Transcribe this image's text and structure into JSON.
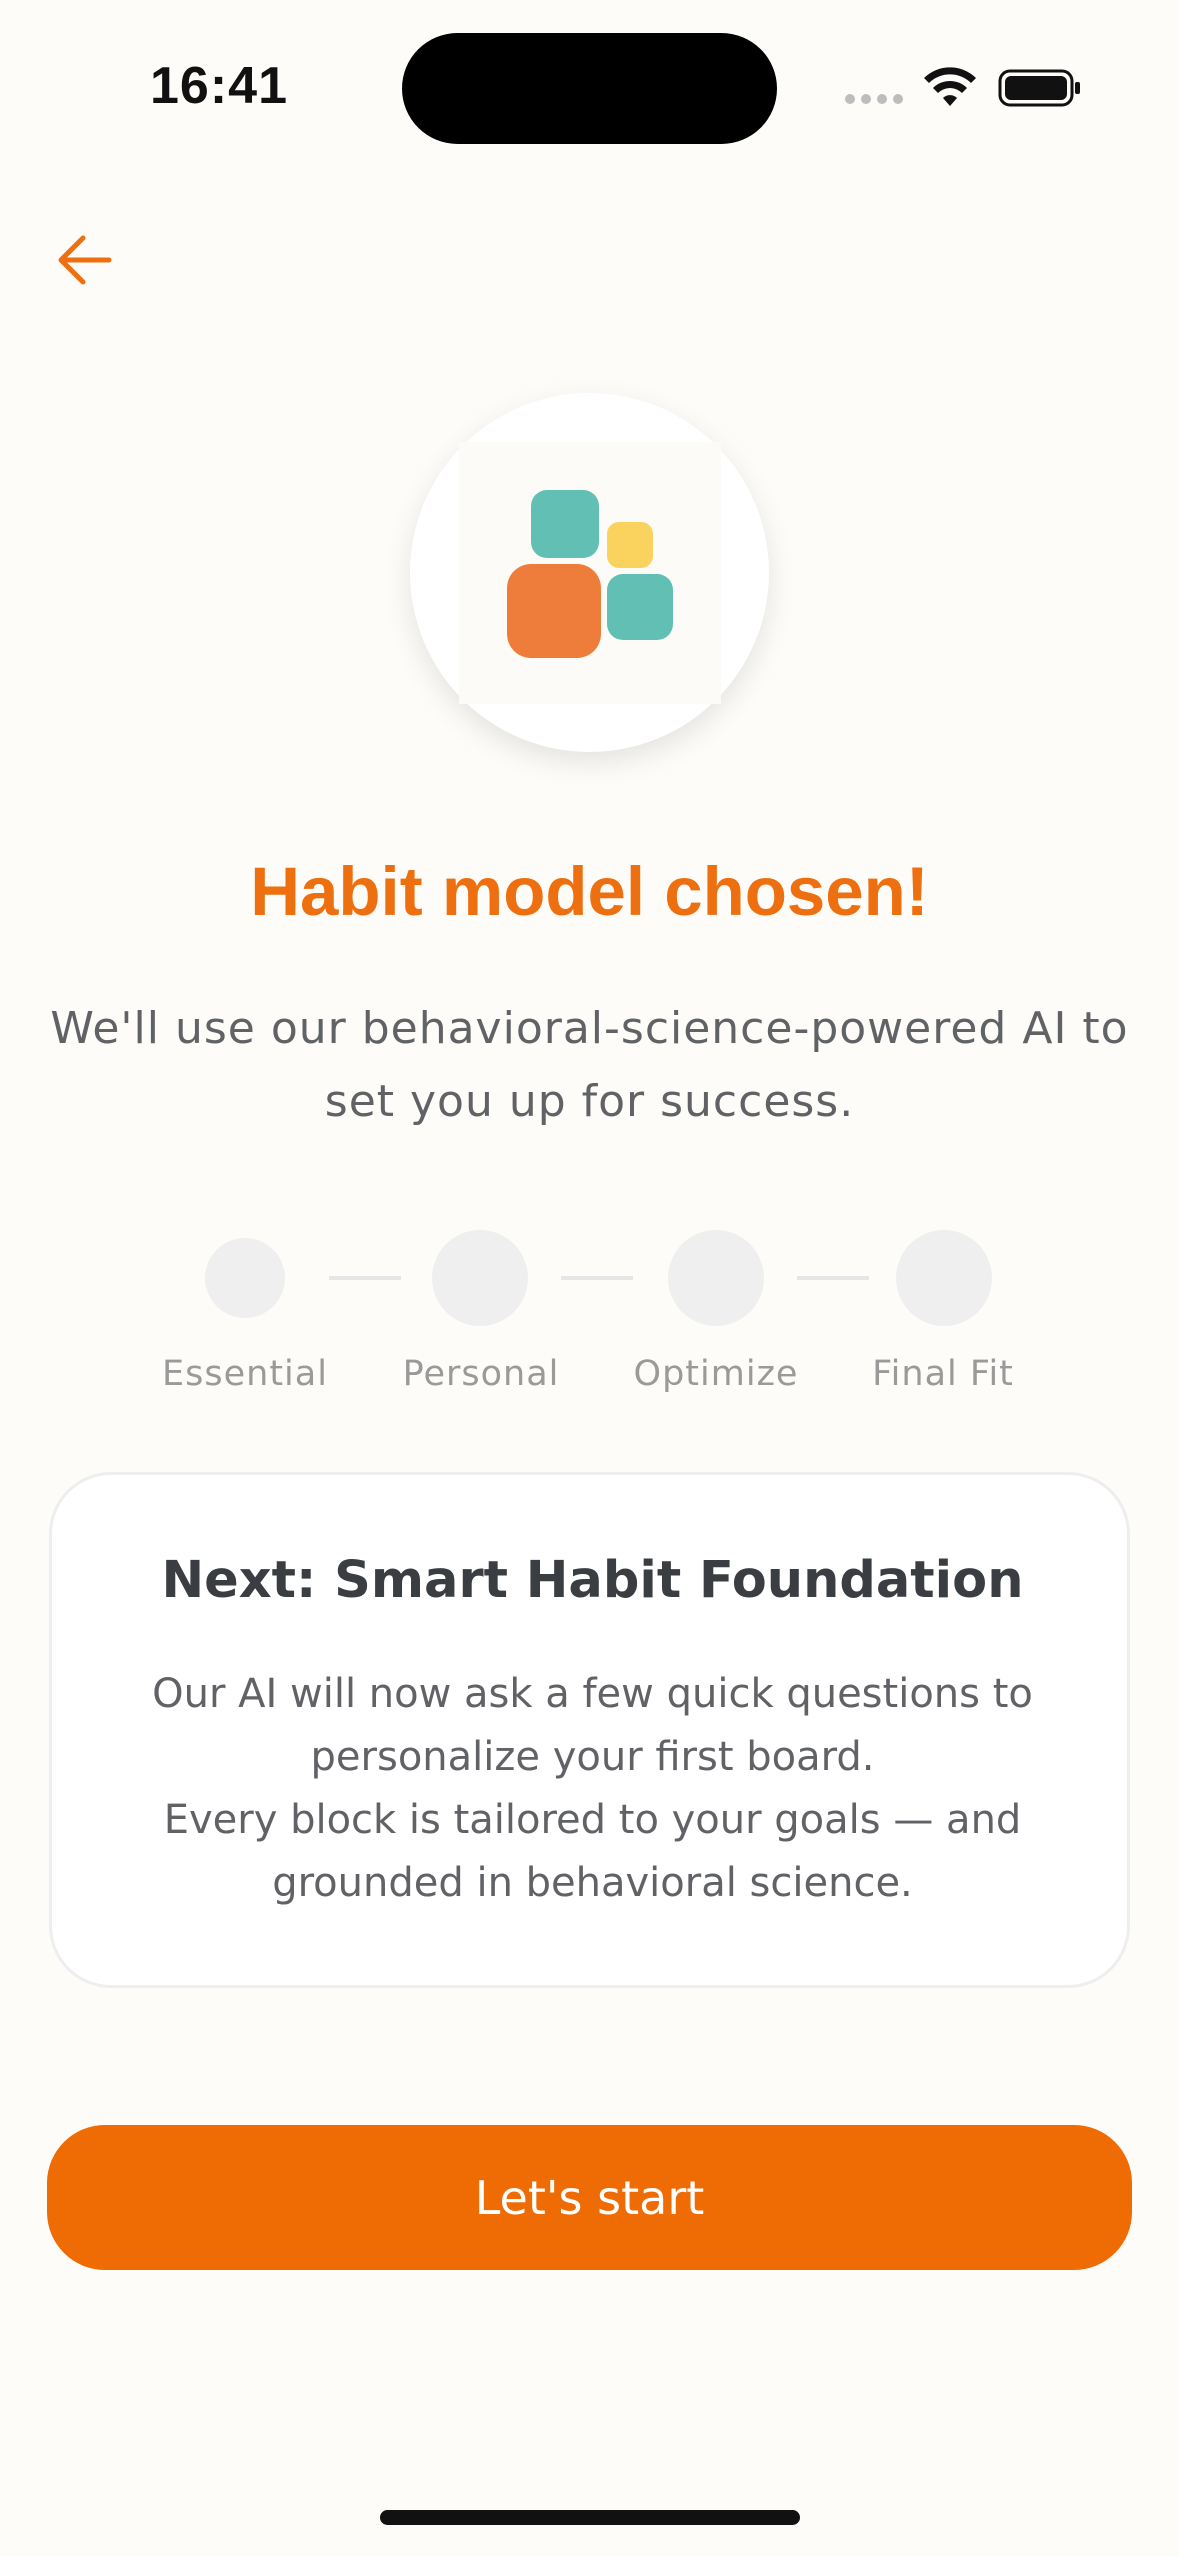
{
  "status_bar": {
    "time": "16:41",
    "icons": [
      "cellular-signal-icon",
      "wifi-icon",
      "battery-icon"
    ]
  },
  "nav": {
    "back_icon": "arrow-left-icon"
  },
  "hero": {
    "logo_icon": "habit-blocks-logo-icon",
    "title": "Habit model chosen!",
    "subtitle": "We'll use our behavioral-science-powered AI to set you up for success."
  },
  "stepper": {
    "steps": [
      {
        "label": "Essential"
      },
      {
        "label": "Personal"
      },
      {
        "label": "Optimize"
      },
      {
        "label": "Final Fit"
      }
    ]
  },
  "card": {
    "title": "Next: Smart Habit Foundation",
    "body_line1": "Our AI will now ask a few quick questions to personalize your first board.",
    "body_line2": "Every block is tailored to your goals — and grounded in behavioral science."
  },
  "cta": {
    "label": "Let's start"
  },
  "colors": {
    "accent": "#EE6F10",
    "button": "#EF6B04",
    "teal": "#62BFB3",
    "yellow": "#FAD25E",
    "orange_block": "#EE7D3C",
    "background": "#FDFCF8"
  }
}
